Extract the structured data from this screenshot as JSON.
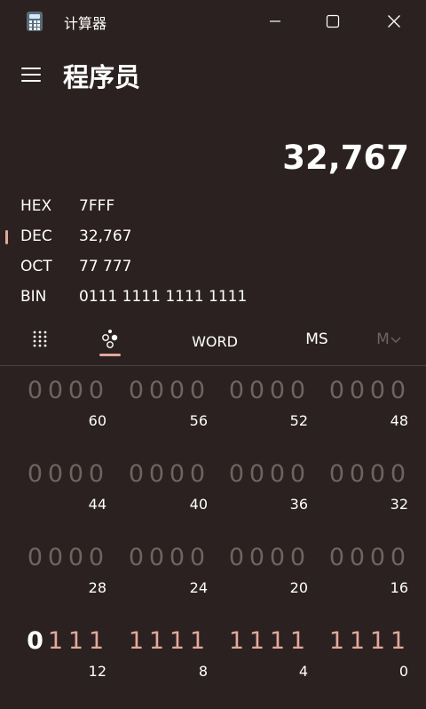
{
  "window": {
    "app_name": "计算器",
    "icons": {
      "minimize": "minimize-icon",
      "maximize": "maximize-icon",
      "close": "close-icon",
      "app": "calculator-icon"
    }
  },
  "header": {
    "mode": "程序员",
    "menu_icon": "hamburger-menu-icon"
  },
  "display": {
    "result": "32,767"
  },
  "radix": [
    {
      "label": "HEX",
      "value": "7FFF",
      "selected": false
    },
    {
      "label": "DEC",
      "value": "32,767",
      "selected": true
    },
    {
      "label": "OCT",
      "value": "77 777",
      "selected": false
    },
    {
      "label": "BIN",
      "value": "0111 1111 1111 1111",
      "selected": false
    }
  ],
  "toolbar": {
    "keypad_icon": "full-keypad-icon",
    "bit_toggle_icon": "bit-toggling-keypad-icon",
    "word_label": "WORD",
    "ms_label": "MS",
    "m_label": "M",
    "m_dropdown_icon": "chevron-down-icon"
  },
  "bit_rows": [
    {
      "nibbles": [
        {
          "bits": [
            "0",
            "0",
            "0",
            "0"
          ],
          "pos": "60"
        },
        {
          "bits": [
            "0",
            "0",
            "0",
            "0"
          ],
          "pos": "56"
        },
        {
          "bits": [
            "0",
            "0",
            "0",
            "0"
          ],
          "pos": "52"
        },
        {
          "bits": [
            "0",
            "0",
            "0",
            "0"
          ],
          "pos": "48"
        }
      ]
    },
    {
      "nibbles": [
        {
          "bits": [
            "0",
            "0",
            "0",
            "0"
          ],
          "pos": "44"
        },
        {
          "bits": [
            "0",
            "0",
            "0",
            "0"
          ],
          "pos": "40"
        },
        {
          "bits": [
            "0",
            "0",
            "0",
            "0"
          ],
          "pos": "36"
        },
        {
          "bits": [
            "0",
            "0",
            "0",
            "0"
          ],
          "pos": "32"
        }
      ]
    },
    {
      "nibbles": [
        {
          "bits": [
            "0",
            "0",
            "0",
            "0"
          ],
          "pos": "28"
        },
        {
          "bits": [
            "0",
            "0",
            "0",
            "0"
          ],
          "pos": "24"
        },
        {
          "bits": [
            "0",
            "0",
            "0",
            "0"
          ],
          "pos": "20"
        },
        {
          "bits": [
            "0",
            "0",
            "0",
            "0"
          ],
          "pos": "16"
        }
      ]
    },
    {
      "nibbles": [
        {
          "bits": [
            "0",
            "1",
            "1",
            "1"
          ],
          "pos": "12"
        },
        {
          "bits": [
            "1",
            "1",
            "1",
            "1"
          ],
          "pos": "8"
        },
        {
          "bits": [
            "1",
            "1",
            "1",
            "1"
          ],
          "pos": "4"
        },
        {
          "bits": [
            "1",
            "1",
            "1",
            "1"
          ],
          "pos": "0"
        }
      ]
    }
  ],
  "colors": {
    "background": "#2b2120",
    "accent": "#e3a99a",
    "bit_off": "#6e6462"
  }
}
